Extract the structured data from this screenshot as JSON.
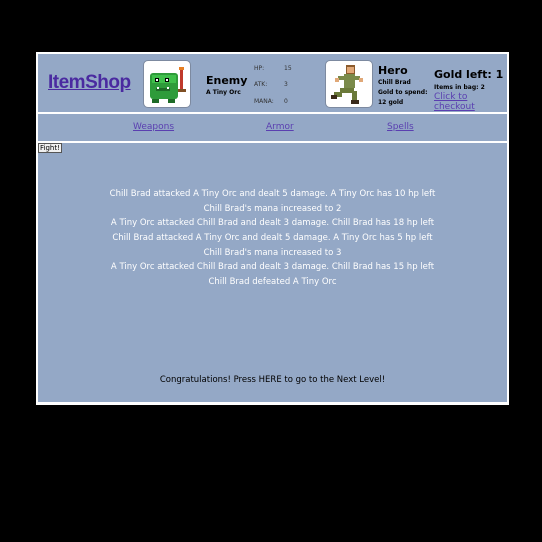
{
  "shop": {
    "title": "ItemShop"
  },
  "enemy": {
    "heading": "Enemy",
    "name": "A Tiny Orc",
    "stats": [
      {
        "label": "HP:",
        "value": "15"
      },
      {
        "label": "ATK:",
        "value": "3"
      },
      {
        "label": "MANA:",
        "value": "0"
      }
    ]
  },
  "hero": {
    "heading": "Hero",
    "name": "Chill Brad",
    "gold_to_spend_label": "Gold to spend:",
    "gold_to_spend": "12 gold"
  },
  "cart": {
    "gold_left": "Gold left: 1",
    "items_in_bag": "Items in bag: 2",
    "checkout": "Click to checkout"
  },
  "nav": {
    "weapons": "Weapons",
    "armor": "Armor",
    "spells": "Spells"
  },
  "battle": {
    "fight_button": "Fight!",
    "log": [
      "Chill Brad attacked A Tiny Orc and dealt 5 damage. A Tiny Orc has 10 hp left",
      "Chill Brad's mana increased to 2",
      "A Tiny Orc attacked Chill Brad and dealt 3 damage. Chill Brad has 18 hp left",
      "Chill Brad attacked A Tiny Orc and dealt 5 damage. A Tiny Orc has 5 hp left",
      "Chill Brad's mana increased to 3",
      "A Tiny Orc attacked Chill Brad and dealt 3 damage. Chill Brad has 15 hp left",
      "Chill Brad defeated A Tiny Orc"
    ],
    "next_level": "Congratulations! Press HERE to go to the Next Level!"
  },
  "colors": {
    "panel": "#94a8c6",
    "link": "#5a3fb0",
    "title": "#4a2aa0"
  }
}
